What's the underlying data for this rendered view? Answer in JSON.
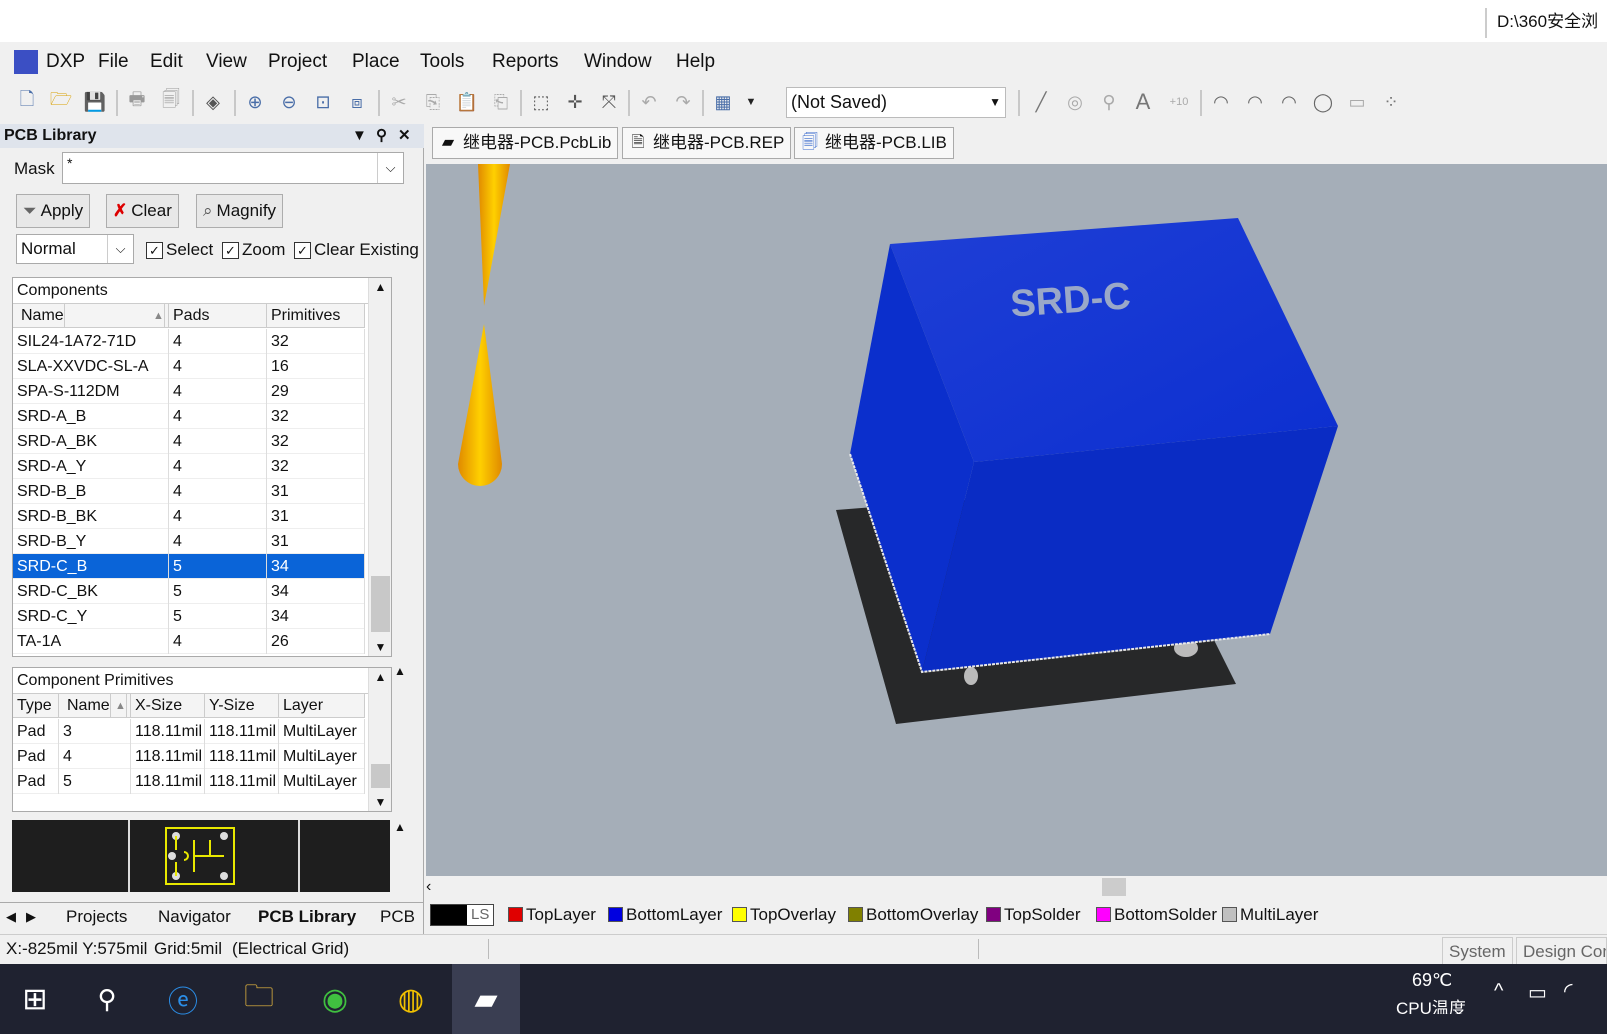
{
  "titlebar": {
    "path": "D:\\360安全浏"
  },
  "menu": {
    "items": [
      {
        "label": "DXP"
      },
      {
        "label": "File"
      },
      {
        "label": "Edit"
      },
      {
        "label": "View"
      },
      {
        "label": "Project"
      },
      {
        "label": "Place"
      },
      {
        "label": "Tools"
      },
      {
        "label": "Reports"
      },
      {
        "label": "Window"
      },
      {
        "label": "Help"
      }
    ]
  },
  "toolbar": {
    "saved_state": "(Not Saved)"
  },
  "panel": {
    "title": "PCB Library",
    "mask_label": "Mask",
    "mask_value": "*",
    "apply": "Apply",
    "clear": "Clear",
    "magnify": "Magnify",
    "mode": "Normal",
    "select": "Select",
    "zoom": "Zoom",
    "clear_existing": "Clear Existing",
    "components": {
      "title": "Components",
      "headers": [
        "Name",
        "Pads",
        "Primitives"
      ],
      "rows": [
        [
          "SIL24-1A72-71D",
          "4",
          "32"
        ],
        [
          "SLA-XXVDC-SL-A",
          "4",
          "16"
        ],
        [
          "SPA-S-112DM",
          "4",
          "29"
        ],
        [
          "SRD-A_B",
          "4",
          "32"
        ],
        [
          "SRD-A_BK",
          "4",
          "32"
        ],
        [
          "SRD-A_Y",
          "4",
          "32"
        ],
        [
          "SRD-B_B",
          "4",
          "31"
        ],
        [
          "SRD-B_BK",
          "4",
          "31"
        ],
        [
          "SRD-B_Y",
          "4",
          "31"
        ],
        [
          "SRD-C_B",
          "5",
          "34"
        ],
        [
          "SRD-C_BK",
          "5",
          "34"
        ],
        [
          "SRD-C_Y",
          "5",
          "34"
        ],
        [
          "TA-1A",
          "4",
          "26"
        ]
      ],
      "selected_index": 9
    },
    "primitives": {
      "title": "Component Primitives",
      "headers": [
        "Type",
        "Name",
        "X-Size",
        "Y-Size",
        "Layer"
      ],
      "rows": [
        [
          "Pad",
          "3",
          "118.11mil",
          "118.11mil",
          "MultiLayer"
        ],
        [
          "Pad",
          "4",
          "118.11mil",
          "118.11mil",
          "MultiLayer"
        ],
        [
          "Pad",
          "5",
          "118.11mil",
          "118.11mil",
          "MultiLayer"
        ]
      ]
    },
    "tabs": [
      "Projects",
      "Navigator",
      "PCB Library",
      "PCB"
    ]
  },
  "doctabs": [
    "继电器-PCB.PcbLib",
    "继电器-PCB.REP",
    "继电器-PCB.LIB"
  ],
  "model_label": "SRD-C",
  "layers": {
    "ls": "LS",
    "items": [
      {
        "label": "TopLayer",
        "color": "#e00000"
      },
      {
        "label": "BottomLayer",
        "color": "#0000e0"
      },
      {
        "label": "TopOverlay",
        "color": "#ffff00"
      },
      {
        "label": "BottomOverlay",
        "color": "#808000"
      },
      {
        "label": "TopSolder",
        "color": "#800080"
      },
      {
        "label": "BottomSolder",
        "color": "#ff00ff"
      },
      {
        "label": "MultiLayer",
        "color": "#c0c0c0"
      }
    ]
  },
  "status": {
    "coords": "X:-825mil Y:575mil",
    "grid": "Grid:5mil",
    "grid_type": "(Electrical Grid)",
    "system": "System",
    "design_compiler": "Design Com"
  },
  "taskbar": {
    "temp": "69℃",
    "temp_label": "CPU温度"
  }
}
